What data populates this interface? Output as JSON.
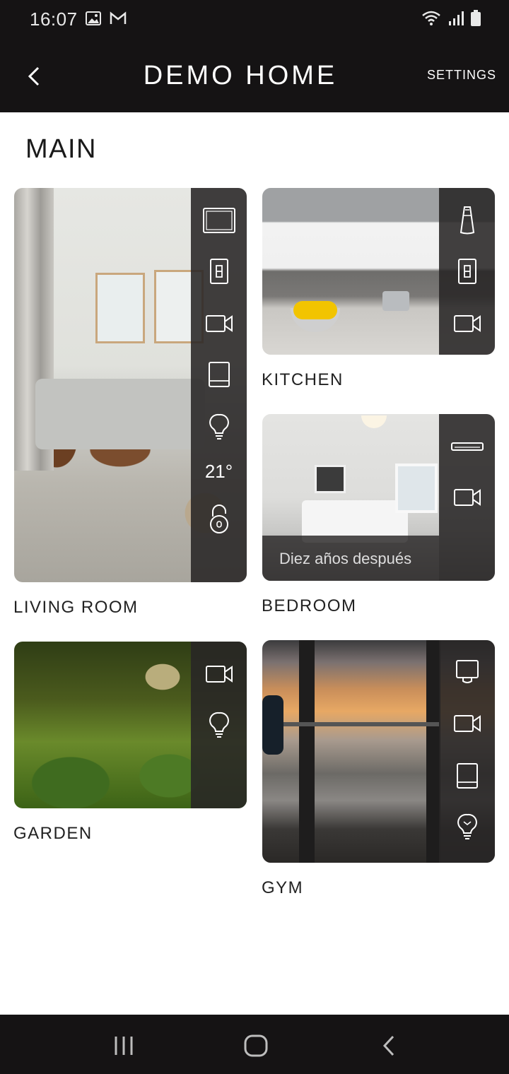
{
  "status_bar": {
    "time": "16:07",
    "left_icons": [
      "image-icon",
      "gmail-icon"
    ],
    "right_icons": [
      "wifi-icon",
      "signal-icon",
      "battery-icon"
    ]
  },
  "app_bar": {
    "title": "DEMO HOME",
    "settings_label": "SETTINGS",
    "back_icon": "chevron-left-icon"
  },
  "section": {
    "title": "MAIN"
  },
  "rooms": [
    {
      "name": "LIVING ROOM",
      "devices": [
        "tv-icon",
        "switch-icon",
        "camera-icon",
        "tablet-icon",
        "bulb-icon",
        "thermostat",
        "lock-icon"
      ],
      "temperature": "21°"
    },
    {
      "name": "KITCHEN",
      "devices": [
        "speaker-icon",
        "switch-icon",
        "camera-icon"
      ]
    },
    {
      "name": "BEDROOM",
      "devices": [
        "air-conditioner-icon",
        "camera-icon"
      ],
      "now_playing": "Diez años después"
    },
    {
      "name": "GARDEN",
      "devices": [
        "camera-icon",
        "bulb-icon"
      ]
    },
    {
      "name": "GYM",
      "devices": [
        "ceiling-lamp-icon",
        "camera-icon",
        "tablet-icon",
        "smart-bulb-icon"
      ]
    }
  ],
  "nav_bar": {
    "buttons": [
      "recent-apps-icon",
      "home-icon",
      "back-icon"
    ]
  },
  "colors": {
    "bar_background": "#151314",
    "panel_background": "#282626",
    "text_dark": "#222222"
  }
}
